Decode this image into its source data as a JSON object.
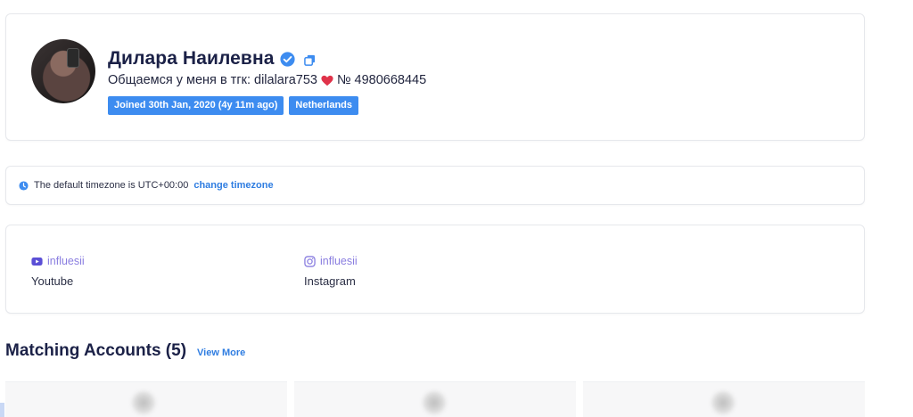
{
  "profile": {
    "name": "Дилара Наилевна",
    "bio_text": "Общаемся у меня в тгк: dilalara753",
    "bio_suffix": "№ 4980668445",
    "badges": [
      "Joined 30th Jan, 2020 (4y 11m ago)",
      "Netherlands"
    ],
    "icons": {
      "verified": "verified-check-icon",
      "copy": "copy-icon",
      "heart": "red-heart-icon"
    }
  },
  "timezone": {
    "text": "The default timezone is UTC+00:00",
    "link": "change timezone"
  },
  "socials": [
    {
      "handle": "influesii",
      "platform": "Youtube",
      "icon": "youtube-icon"
    },
    {
      "handle": "influesii",
      "platform": "Instagram",
      "icon": "instagram-icon"
    }
  ],
  "matching": {
    "title": "Matching Accounts (5)",
    "view_more": "View More"
  },
  "colors": {
    "accent": "#3d8cf0",
    "link": "#2f7de1",
    "heading": "#1b2147",
    "social_handle": "#8a7ee0"
  }
}
